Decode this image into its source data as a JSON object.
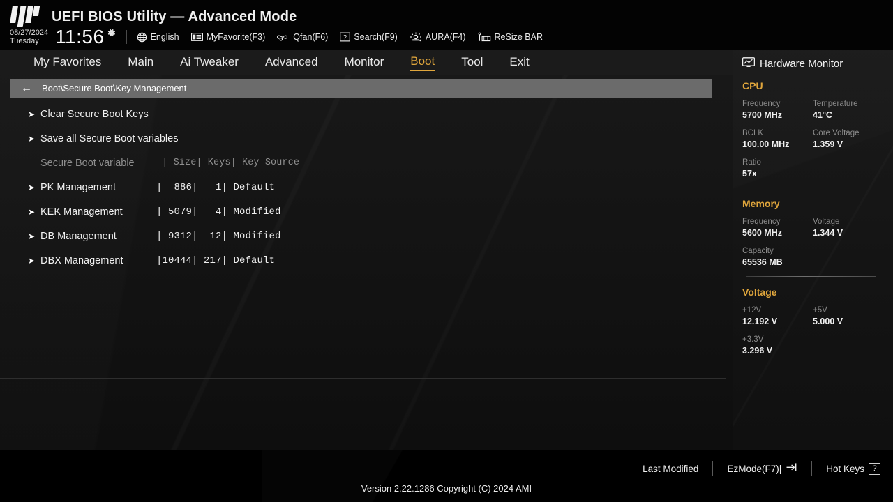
{
  "header": {
    "logo_icon": "tuf-logo-icon",
    "title": "UEFI BIOS Utility — Advanced Mode",
    "date": "08/27/2024",
    "weekday": "Tuesday",
    "time": "11:56",
    "gear_icon": "gear-icon",
    "items": [
      {
        "icon": "globe-icon",
        "label": "English"
      },
      {
        "icon": "favorite-icon",
        "label": "MyFavorite(F3)"
      },
      {
        "icon": "qfan-icon",
        "label": "Qfan(F6)"
      },
      {
        "icon": "search-icon",
        "label": "Search(F9)"
      },
      {
        "icon": "aura-icon",
        "label": "AURA(F4)"
      },
      {
        "icon": "resizebar-icon",
        "label": "ReSize BAR"
      }
    ]
  },
  "tabs": [
    {
      "label": "My Favorites",
      "active": false
    },
    {
      "label": "Main",
      "active": false
    },
    {
      "label": "Ai Tweaker",
      "active": false
    },
    {
      "label": "Advanced",
      "active": false
    },
    {
      "label": "Monitor",
      "active": false
    },
    {
      "label": "Boot",
      "active": true
    },
    {
      "label": "Tool",
      "active": false
    },
    {
      "label": "Exit",
      "active": false
    }
  ],
  "breadcrumb": {
    "back_icon": "back-arrow-icon",
    "path": "Boot\\Secure Boot\\Key Management"
  },
  "menu": {
    "actions": [
      {
        "arrow": "submenu-arrow-icon",
        "label": "Clear Secure Boot Keys"
      },
      {
        "arrow": "submenu-arrow-icon",
        "label": "Save all Secure Boot variables"
      }
    ],
    "column_header": {
      "label": "Secure Boot variable",
      "cols": " | Size| Keys| Key Source"
    },
    "rows": [
      {
        "arrow": "submenu-arrow-icon",
        "label": "PK Management",
        "cols": "|  886|   1| Default"
      },
      {
        "arrow": "submenu-arrow-icon",
        "label": "KEK Management",
        "cols": "| 5079|   4| Modified"
      },
      {
        "arrow": "submenu-arrow-icon",
        "label": "DB Management",
        "cols": "| 9312|  12| Modified"
      },
      {
        "arrow": "submenu-arrow-icon",
        "label": "DBX Management",
        "cols": "|10444| 217| Default"
      }
    ],
    "info_icon": "info-icon"
  },
  "hardware_monitor": {
    "icon": "monitor-icon",
    "title": "Hardware Monitor",
    "sections": [
      {
        "name": "CPU",
        "rows": [
          [
            {
              "key": "Frequency",
              "value": "5700 MHz"
            },
            {
              "key": "Temperature",
              "value": "41°C"
            }
          ],
          [
            {
              "key": "BCLK",
              "value": "100.00 MHz"
            },
            {
              "key": "Core Voltage",
              "value": "1.359 V"
            }
          ],
          [
            {
              "key": "Ratio",
              "value": "57x"
            }
          ]
        ]
      },
      {
        "name": "Memory",
        "rows": [
          [
            {
              "key": "Frequency",
              "value": "5600 MHz"
            },
            {
              "key": "Voltage",
              "value": "1.344 V"
            }
          ],
          [
            {
              "key": "Capacity",
              "value": "65536 MB"
            }
          ]
        ]
      },
      {
        "name": "Voltage",
        "rows": [
          [
            {
              "key": "+12V",
              "value": "12.192 V"
            },
            {
              "key": "+5V",
              "value": "5.000 V"
            }
          ],
          [
            {
              "key": "+3.3V",
              "value": "3.296 V"
            }
          ]
        ]
      }
    ]
  },
  "footer": {
    "last_modified": "Last Modified",
    "ezmode": "EzMode(F7)|",
    "ezmode_icon": "enter-arrow-icon",
    "hotkeys": "Hot Keys",
    "hotkeys_icon": "question-box-icon",
    "hotkeys_glyph": "?",
    "version": "Version 2.22.1286 Copyright (C) 2024 AMI"
  },
  "colors": {
    "accent": "#e0a63c",
    "panel_bg": "#141414",
    "breadcrumb_bg": "#6b6b6b",
    "text": "#f0f0f0",
    "muted": "#8c8c8c"
  }
}
